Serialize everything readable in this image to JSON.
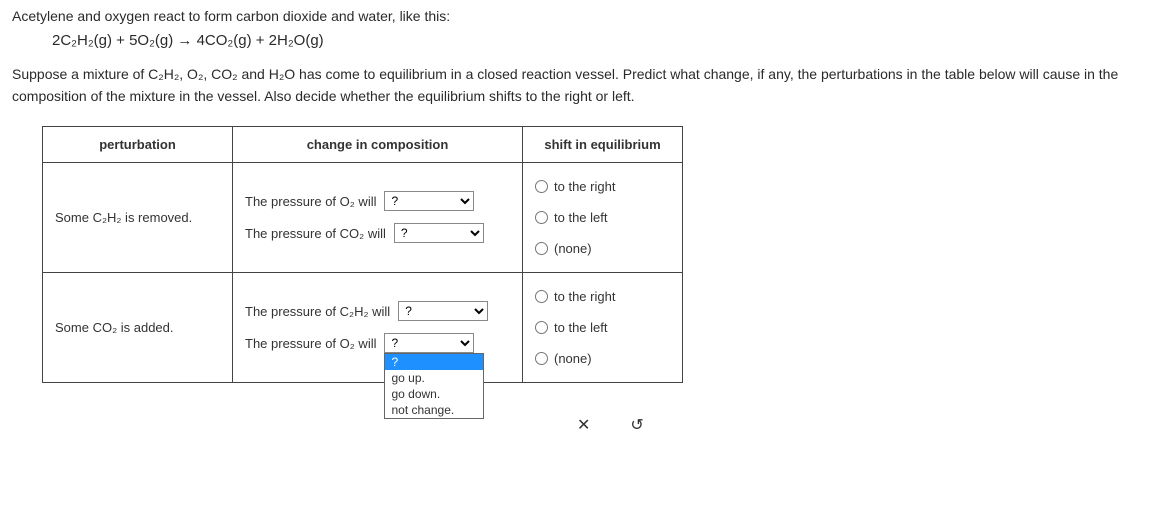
{
  "intro": "Acetylene and oxygen react to form carbon dioxide and water, like this:",
  "equation": "2C₂H₂(g) + 5O₂(g) → 4CO₂(g) + 2H₂O(g)",
  "description_part1": "Suppose a mixture of C₂H₂, O₂, CO₂ and H₂O has come to equilibrium in a closed reaction vessel. Predict what change, if any, the perturbations in the table below will cause in the composition of the mixture in the vessel. Also decide whether the equilibrium shifts to the right or left.",
  "table": {
    "headers": {
      "perturbation": "perturbation",
      "change": "change in composition",
      "shift": "shift in equilibrium"
    },
    "rows": [
      {
        "perturbation": "Some C₂H₂ is removed.",
        "changes": [
          {
            "label": "The pressure of O₂ will",
            "value": "?"
          },
          {
            "label": "The pressure of CO₂ will",
            "value": "?"
          }
        ]
      },
      {
        "perturbation": "Some CO₂ is added.",
        "changes": [
          {
            "label": "The pressure of C₂H₂ will",
            "value": "?"
          },
          {
            "label": "The pressure of O₂ will",
            "value": "?"
          }
        ]
      }
    ],
    "shift_options": {
      "right": "to the right",
      "left": "to the left",
      "none": "(none)"
    },
    "dropdown_options": {
      "placeholder": "?",
      "up": "go up.",
      "down": "go down.",
      "nochange": "not change."
    }
  },
  "icons": {
    "close": "✕",
    "reset": "↺"
  }
}
